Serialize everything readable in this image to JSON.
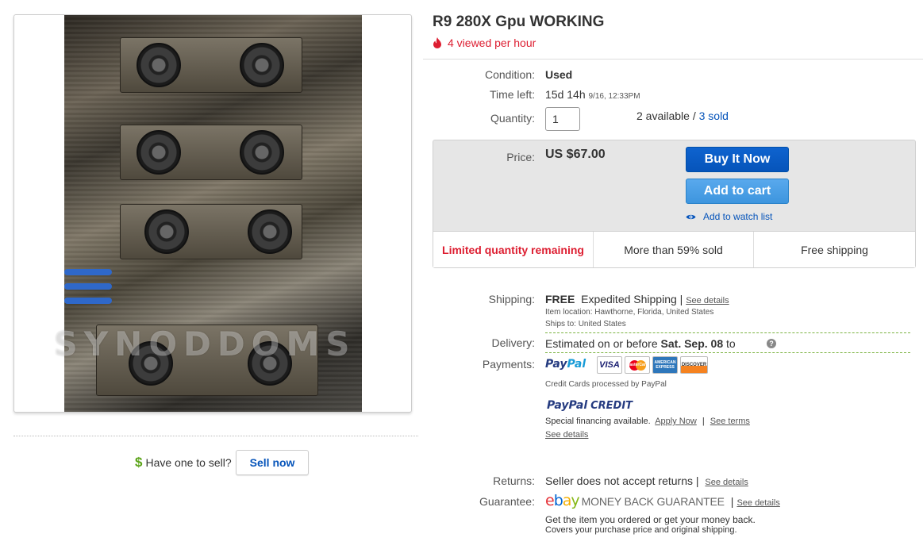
{
  "listing": {
    "title": "R9 280X Gpu WORKING",
    "viewed": "4 viewed per hour",
    "image_watermark": "SYNODDOMS"
  },
  "details": {
    "condition_label": "Condition:",
    "condition_value": "Used",
    "time_left_label": "Time left:",
    "time_left_value": "15d 14h",
    "time_left_date": "9/16, 12:33PM",
    "quantity_label": "Quantity:",
    "quantity_value": "1",
    "available": "2 available",
    "separator": " / ",
    "sold": "3 sold"
  },
  "price": {
    "label": "Price:",
    "value": "US $67.00",
    "buy_now": "Buy It Now",
    "add_to_cart": "Add to cart",
    "watch": "Add to watch list"
  },
  "stats": [
    "Limited quantity remaining",
    "More than 59% sold",
    "Free shipping"
  ],
  "shipping": {
    "label": "Shipping:",
    "free": "FREE",
    "method": "Expedited Shipping",
    "bar": "|",
    "see_details": "See details",
    "item_location": "Item location:  Hawthorne, Florida, United States",
    "ships_to": "Ships to:  United States"
  },
  "delivery": {
    "label": "Delivery:",
    "text": "Estimated on or before ",
    "date": "Sat. Sep. 08",
    "to": " to",
    "help": "?"
  },
  "payments": {
    "label": "Payments:",
    "paypal_a": "Pay",
    "paypal_b": "Pal",
    "cards": [
      "VISA",
      "MasterCard",
      "AMERICAN EXPRESS",
      "DISCOVER"
    ],
    "credit_cards_note": "Credit Cards processed by PayPal",
    "credit_a": "PayPal",
    "credit_b": "CREDIT",
    "financing": "Special financing available.",
    "apply_now": "Apply Now",
    "bar": "|",
    "see_terms": "See terms",
    "see_details": "See details"
  },
  "returns": {
    "label": "Returns:",
    "value": "Seller does not accept returns",
    "bar": "|",
    "see_details": "See details"
  },
  "guarantee": {
    "label": "Guarantee:",
    "logo_letters": [
      "e",
      "b",
      "a",
      "y"
    ],
    "logo_colors": [
      "#e53238",
      "#0064d2",
      "#f5af02",
      "#86b817"
    ],
    "mbg": "MONEY BACK GUARANTEE",
    "bar": "|",
    "see_details": "See details",
    "line1": "Get the item you ordered or get your money back.",
    "line2": "Covers your purchase price and original shipping."
  },
  "sell": {
    "dollar": "$",
    "prompt": "Have one to sell?",
    "button": "Sell now"
  },
  "colors": {
    "accent_blue": "#0654ba",
    "alert_red": "#dd1e31",
    "success_green": "#5ba319"
  }
}
